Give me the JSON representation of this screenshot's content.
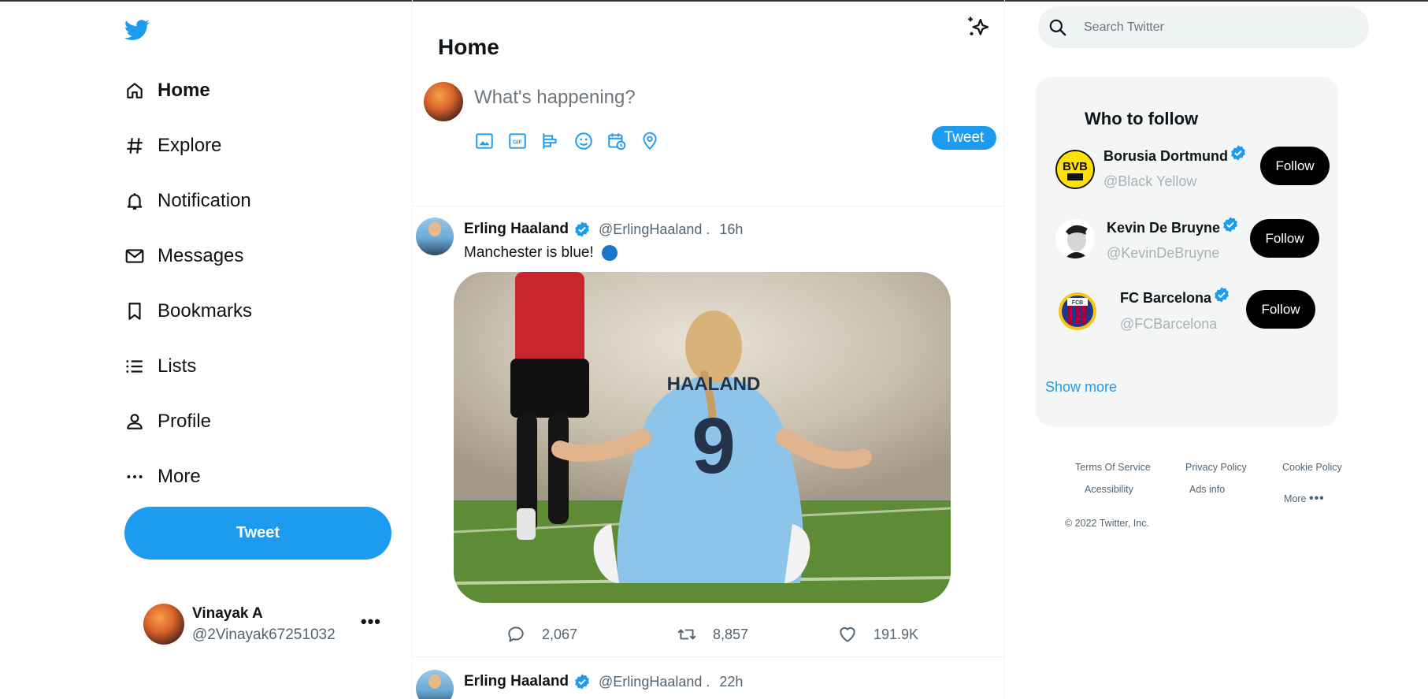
{
  "nav": {
    "items": [
      {
        "label": "Home",
        "icon": "home-icon"
      },
      {
        "label": "Explore",
        "icon": "hashtag-icon"
      },
      {
        "label": "Notification",
        "icon": "bell-icon"
      },
      {
        "label": "Messages",
        "icon": "envelope-icon"
      },
      {
        "label": "Bookmarks",
        "icon": "bookmark-icon"
      },
      {
        "label": "Lists",
        "icon": "list-icon"
      },
      {
        "label": "Profile",
        "icon": "person-icon"
      },
      {
        "label": "More",
        "icon": "more-icon"
      }
    ],
    "tweet_button": "Tweet"
  },
  "account": {
    "name": "Vinayak A",
    "handle": "@2Vinayak67251032"
  },
  "feed": {
    "title": "Home",
    "compose_placeholder": "What's happening?",
    "compose_tweet_button": "Tweet",
    "posts": [
      {
        "author": "Erling Haaland",
        "handle": "@ErlingHaaland .",
        "time": "16h",
        "text": "Manchester is blue!",
        "image_jersey_name": "HAALAND",
        "image_jersey_number": "9",
        "replies": "2,067",
        "retweets": "8,857",
        "likes": "191.9K"
      },
      {
        "author": "Erling Haaland",
        "handle": "@ErlingHaaland .",
        "time": "22h"
      }
    ]
  },
  "search": {
    "placeholder": "Search Twitter"
  },
  "who_to_follow": {
    "title": "Who to follow",
    "suggestions": [
      {
        "name": "Borusia Dortmund",
        "handle": "@Black Yellow",
        "button": "Follow",
        "logo_text": "BVB"
      },
      {
        "name": "Kevin De Bruyne",
        "handle": "@KevinDeBruyne",
        "button": "Follow"
      },
      {
        "name": "FC Barcelona",
        "handle": "@FCBarcelona",
        "button": "Follow",
        "logo_text": "FCB"
      }
    ],
    "show_more": "Show more"
  },
  "footer": {
    "terms": "Terms Of Service",
    "privacy": "Privacy Policy",
    "cookie": "Cookie Policy",
    "accessibility": "Acessibility",
    "ads": "Ads info",
    "more": "More",
    "copyright": "© 2022 Twitter, Inc."
  },
  "colors": {
    "accent": "#1d9bf0",
    "follow_button": "#000000",
    "verified": "#1d9bf0"
  }
}
